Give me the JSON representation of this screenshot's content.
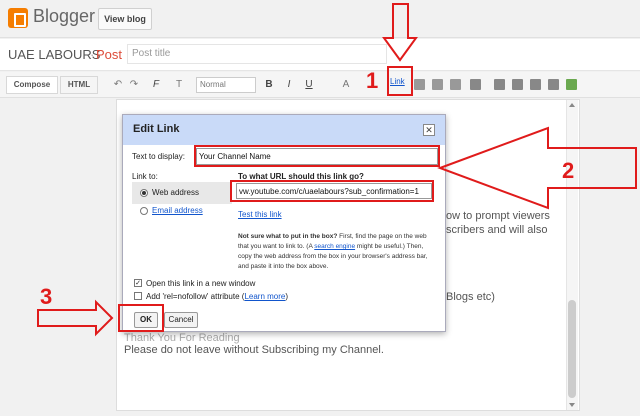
{
  "header": {
    "brand": "Blogger",
    "view_blog": "View blog"
  },
  "post": {
    "blog_name": "UAE LABOURS",
    "separator": "·",
    "crumb": "Post",
    "title_placeholder": "Post title"
  },
  "toolbar": {
    "compose": "Compose",
    "html": "HTML",
    "font": "Normal",
    "bold": "B",
    "italic": "I",
    "underline": "U",
    "text_color": "A",
    "link": "Link",
    "undo": "↶",
    "redo": "↷",
    "font_family": "F",
    "font_size": "T"
  },
  "editor": {
    "bg_lines": [
      "ow to prompt viewers",
      "scribers and will also",
      "Blogs etc)",
      "Thank You For Reading",
      "Please do not leave without Subscribing my Channel."
    ]
  },
  "dialog": {
    "title": "Edit Link",
    "close": "✕",
    "text_to_display_label": "Text to display:",
    "text_to_display_value": "Your Channel Name",
    "link_to_label": "Link to:",
    "url_question": "To what URL should this link go?",
    "url_value": "vw.youtube.com/c/uaelabours?sub_confirmation=1",
    "option_web": "Web address",
    "option_email": "Email address",
    "test_link": "Test this link",
    "help_bold": "Not sure what to put in the box?",
    "help_1": " First, find the page on the web that you want to link to. (A ",
    "help_link": "search engine",
    "help_2": " might be useful.) Then, copy the web address from the box in your browser's address bar, and paste it into the box above.",
    "checkbox_new_window": "Open this link in a new window",
    "checkbox_nofollow": "Add 'rel=nofollow' attribute (",
    "learn_more": "Learn more",
    "checkbox_nofollow_end": ")",
    "ok": "OK",
    "cancel": "Cancel",
    "new_window_checked": true,
    "nofollow_checked": false
  },
  "annotations": {
    "step1": "1",
    "step2": "2",
    "step3": "3",
    "color": "#e01b1b"
  }
}
